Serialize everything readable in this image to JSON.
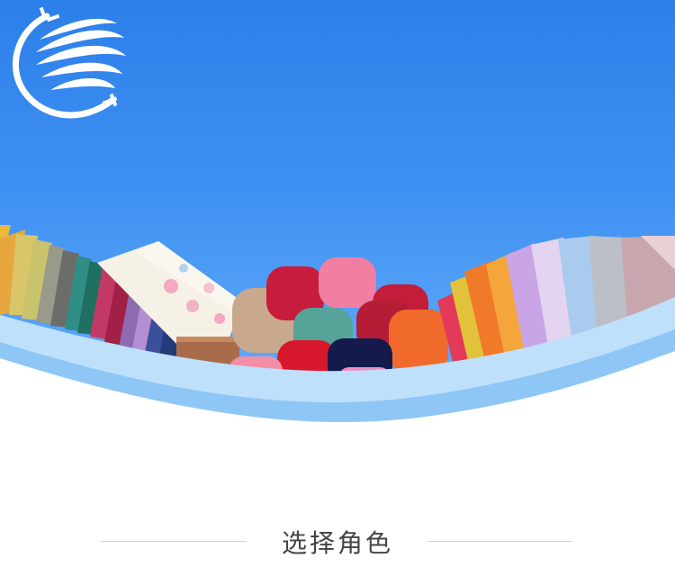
{
  "section": {
    "title": "选择角色"
  },
  "banner": {
    "logo_icon": "globe-swoosh-logo-icon",
    "image": "folded-fabric-rolls-banner",
    "colors": {
      "sky_top": "#2c7fe9",
      "sky_bottom": "#69b1fb",
      "wave_light": "#bfe0fb",
      "wave_mid": "#8ec6f6"
    }
  }
}
